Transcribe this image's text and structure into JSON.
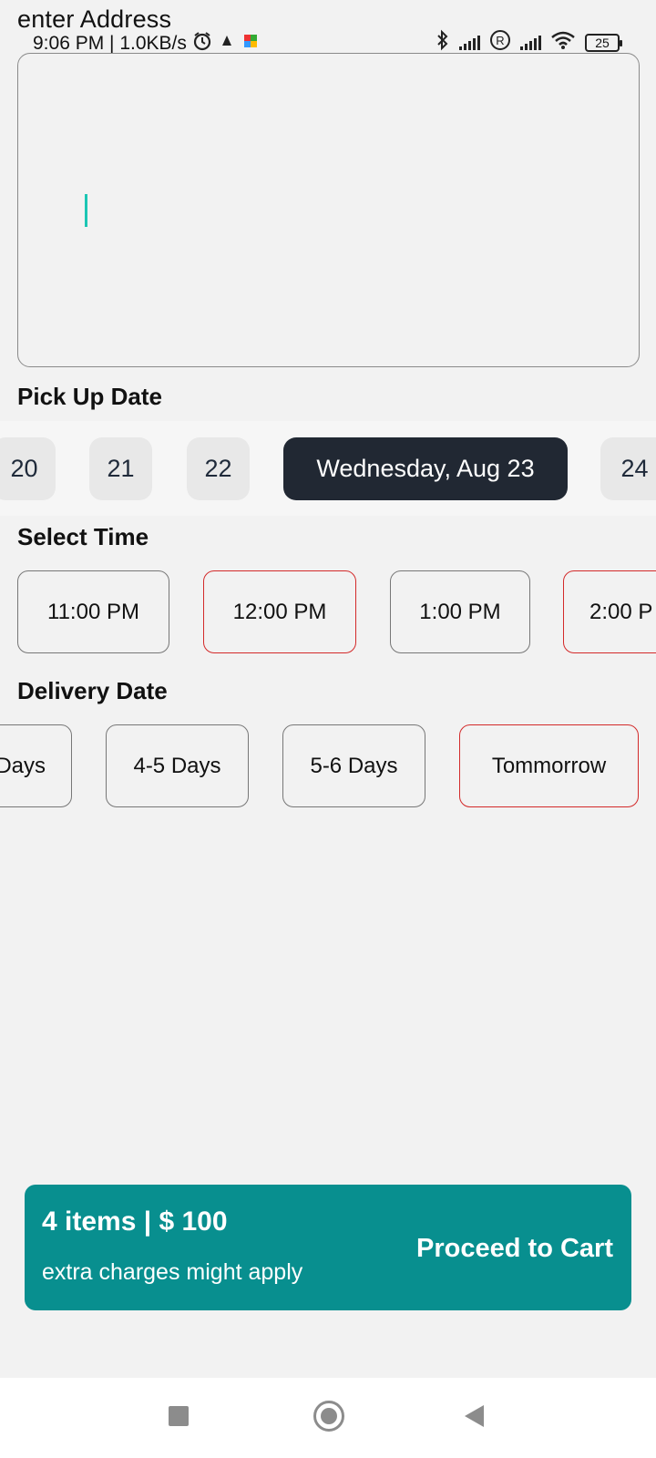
{
  "status_bar": {
    "time_speed": "9:06 PM | 1.0KB/s",
    "battery": "25"
  },
  "address": {
    "label": "enter Address",
    "value": ""
  },
  "pickup": {
    "title": "Pick Up Date",
    "dates": [
      "20",
      "21",
      "22",
      "Wednesday, Aug 23",
      "24"
    ],
    "selected": "Wednesday, Aug 23"
  },
  "time": {
    "title": "Select Time",
    "slots": [
      "11:00 PM",
      "12:00 PM",
      "1:00 PM",
      "2:00 P"
    ]
  },
  "delivery": {
    "title": "Delivery Date",
    "options": [
      "Days",
      "4-5 Days",
      "5-6 Days",
      "Tommorrow"
    ]
  },
  "cart": {
    "summary": "4 items | $ 100",
    "note": "extra charges might apply",
    "cta": "Proceed to Cart"
  },
  "colors": {
    "accent": "#088f8f",
    "selected_date": "#212833",
    "highlight_border": "#d32a2a",
    "caret": "#1cc6b4"
  }
}
